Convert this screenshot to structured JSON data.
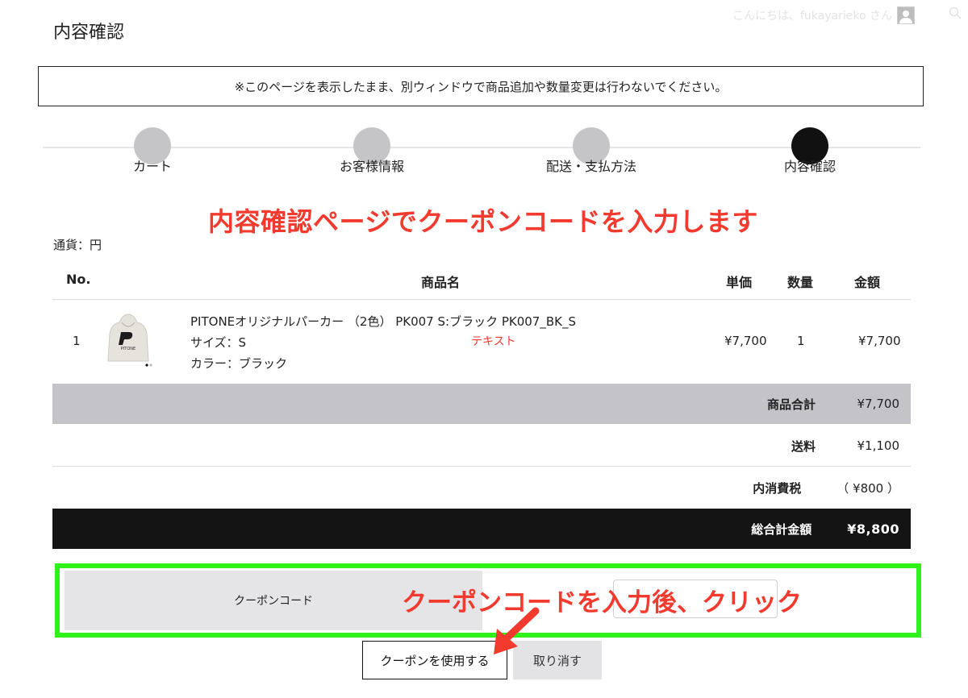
{
  "header": {
    "title": "内容確認",
    "greeting": "こんにちは、fukayarieko さん"
  },
  "notice": "※このページを表示したまま、別ウィンドウで商品追加や数量変更は行わないでください。",
  "steps": [
    {
      "label": "カート",
      "active": false
    },
    {
      "label": "お客様情報",
      "active": false
    },
    {
      "label": "配送・支払方法",
      "active": false
    },
    {
      "label": "内容確認",
      "active": true
    }
  ],
  "annotations": {
    "top": "内容確認ページでクーポンコードを入力します",
    "coupon": "クーポンコードを入力後、クリック"
  },
  "currency_label": "通貨：円",
  "table": {
    "headers": [
      "No.",
      "商品名",
      "単価",
      "数量",
      "金額"
    ],
    "rows": [
      {
        "no": "1",
        "name": "PITONEオリジナルパーカー （2色） PK007 S:ブラック PK007_BK_S",
        "size": "サイズ：S",
        "color": "カラー：ブラック",
        "note": "テキスト",
        "unit_price": "¥7,700",
        "qty": "1",
        "amount": "¥7,700",
        "thumb_text": "PITONE"
      }
    ]
  },
  "summary": {
    "subtotal_label": "商品合計",
    "subtotal": "¥7,700",
    "shipping_label": "送料",
    "shipping": "¥1,100",
    "tax_label": "内消費税",
    "tax": "（ ¥800 ）",
    "total_label": "総合計金額",
    "total": "¥8,800"
  },
  "coupon": {
    "label": "クーポンコード",
    "input_value": "",
    "use_button": "クーポンを使用する",
    "cancel_button": "取り消す"
  },
  "colors": {
    "annotation": "#f23a2e",
    "highlight_frame": "#2ef21a",
    "step_inactive": "#c5c5c8",
    "step_active": "#111111"
  }
}
